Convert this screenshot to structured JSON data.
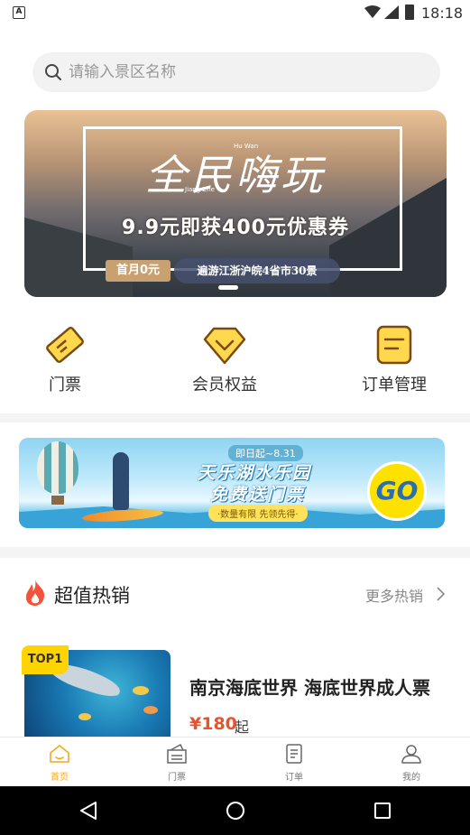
{
  "status_bar": {
    "time": "18:18",
    "left_icon": "A"
  },
  "search": {
    "placeholder": "请输入景区名称",
    "value": ""
  },
  "banner": {
    "title": "全民嗨玩",
    "small_top": "Hu Wan",
    "small_left": "Jiang Zhe",
    "promo": "9.9元即获400元优惠券",
    "tag_month": "首月0元",
    "tag_tour": "遍游江浙沪皖4省市30景"
  },
  "quick_menu": [
    {
      "label": "门票",
      "icon": "ticket-icon"
    },
    {
      "label": "会员权益",
      "icon": "member-diamond-icon"
    },
    {
      "label": "订单管理",
      "icon": "order-list-icon"
    }
  ],
  "ad": {
    "date": "即日起~8.31",
    "line1": "天乐湖水乐园",
    "line2": "免费送门票",
    "line3": "·数量有限 先领先得·",
    "go": "GO"
  },
  "hot": {
    "title": "超值热销",
    "more": "更多热销",
    "product": {
      "tag": "TOP1",
      "name": "南京海底世界 海底世界成人票",
      "price": "¥180",
      "price_suffix": "起"
    }
  },
  "tabbar": [
    {
      "label": "首页",
      "active": true
    },
    {
      "label": "门票",
      "active": false
    },
    {
      "label": "订单",
      "active": false
    },
    {
      "label": "我的",
      "active": false
    }
  ],
  "colors": {
    "accent": "#f2a81d",
    "price": "#e8532f",
    "icon_fill": "#ffd84d",
    "icon_stroke": "#7a4a10"
  }
}
